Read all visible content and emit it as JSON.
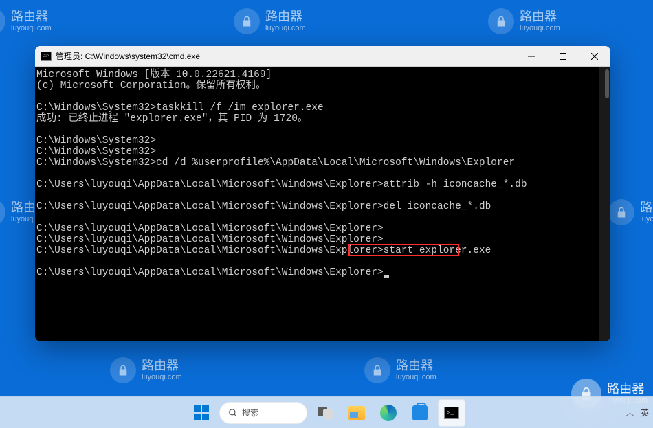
{
  "watermark": {
    "cn": "路由器",
    "py": "luyouqi.com"
  },
  "window": {
    "title": "管理员: C:\\Windows\\system32\\cmd.exe"
  },
  "terminal": {
    "lines": [
      "Microsoft Windows [版本 10.0.22621.4169]",
      "(c) Microsoft Corporation。保留所有权利。",
      "",
      "C:\\Windows\\System32>taskkill /f /im explorer.exe",
      "成功: 已终止进程 \"explorer.exe\"，其 PID 为 1720。",
      "",
      "C:\\Windows\\System32>",
      "C:\\Windows\\System32>",
      "C:\\Windows\\System32>cd /d %userprofile%\\AppData\\Local\\Microsoft\\Windows\\Explorer",
      "",
      "C:\\Users\\luyouqi\\AppData\\Local\\Microsoft\\Windows\\Explorer>attrib -h iconcache_*.db",
      "",
      "C:\\Users\\luyouqi\\AppData\\Local\\Microsoft\\Windows\\Explorer>del iconcache_*.db",
      "",
      "C:\\Users\\luyouqi\\AppData\\Local\\Microsoft\\Windows\\Explorer>",
      "C:\\Users\\luyouqi\\AppData\\Local\\Microsoft\\Windows\\Explorer>",
      "C:\\Users\\luyouqi\\AppData\\Local\\Microsoft\\Windows\\Explorer>start explorer.exe",
      "",
      "C:\\Users\\luyouqi\\AppData\\Local\\Microsoft\\Windows\\Explorer>"
    ],
    "highlighted_command": "start explorer.exe"
  },
  "taskbar": {
    "search_label": "搜索",
    "ime": "英"
  }
}
